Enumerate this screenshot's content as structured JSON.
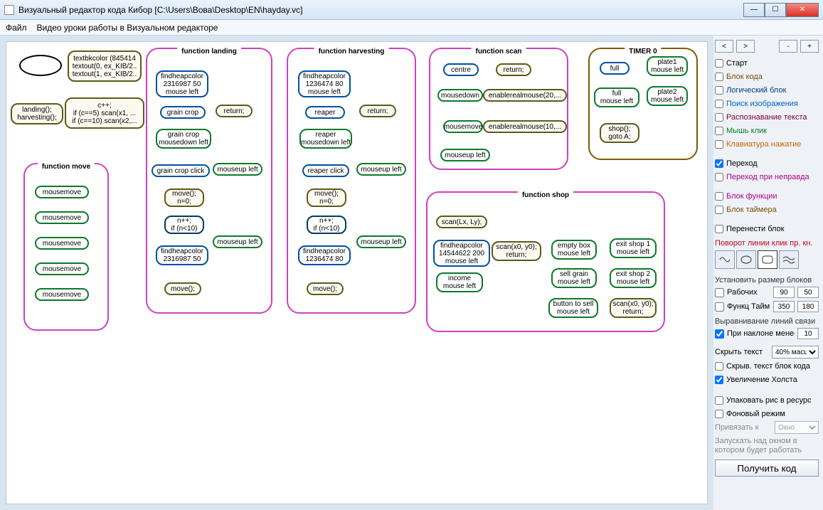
{
  "window": {
    "title": "Визуальный редактор кода Кибор  [C:\\Users\\Вова\\Desktop\\EN\\hayday.vc]"
  },
  "menubar": {
    "file": "Файл",
    "video": "Видео уроки работы в Визуальном редакторе"
  },
  "nav": {
    "back": "<",
    "fwd": ">",
    "minus": "-",
    "plus": "+"
  },
  "tools": [
    {
      "name": "start",
      "label": "Старт",
      "cls": "c-black",
      "checked": false
    },
    {
      "name": "code",
      "label": "Блок кода",
      "cls": "c-brown",
      "checked": false
    },
    {
      "name": "logic",
      "label": "Логический блок",
      "cls": "c-navy",
      "checked": false
    },
    {
      "name": "imgsearch",
      "label": "Поиск изображения",
      "cls": "c-blue",
      "checked": false
    },
    {
      "name": "ocr",
      "label": "Распознавание текста",
      "cls": "c-dred",
      "checked": false
    },
    {
      "name": "mouse",
      "label": "Мышь клик",
      "cls": "c-green",
      "checked": false
    },
    {
      "name": "keyboard",
      "label": "Клавиатура нажатие",
      "cls": "c-orange",
      "checked": false
    }
  ],
  "trans": {
    "go": {
      "label": "Переход",
      "checked": true
    },
    "gofalse": {
      "label": "Переход при неправда",
      "checked": false,
      "cls": "c-magenta"
    }
  },
  "blocks": {
    "func": {
      "label": "Блок функции",
      "cls": "c-magenta"
    },
    "timer": {
      "label": "Блок таймера",
      "cls": "c-brown"
    },
    "move": {
      "label": "Перенести блок"
    }
  },
  "rotate_label": "Поворот линии клик пр. кн.",
  "sizes": {
    "heading": "Установить размер блоков",
    "work": {
      "label": "Рабочих",
      "w": "90",
      "h": "50"
    },
    "func": {
      "label": "Функц Тайм",
      "w": "350",
      "h": "180"
    }
  },
  "align": {
    "heading": "Выравнивание линий связи",
    "slope": {
      "label": "При наклоне менее",
      "val": "10",
      "checked": true
    }
  },
  "hide": {
    "label": "Скрыть текст",
    "value": "40% масш"
  },
  "hideblock": {
    "label": "Скрыв. текст блок кода",
    "checked": false
  },
  "zoom": {
    "label": "Увеличение Холста",
    "checked": true
  },
  "pack": {
    "label": "Упаковать рис в ресурс",
    "checked": false
  },
  "bgmode": {
    "label": "Фоновый режим",
    "checked": false
  },
  "bind": {
    "label": "Привязать к",
    "value": "Окно"
  },
  "hint": "Запускать над окном в котором будет работать",
  "getcode": "Получить код",
  "groups": {
    "move": "function move",
    "land": "function landing",
    "harv": "function harvesting",
    "scan": "function scan",
    "timer": "TIMER 0",
    "shop": "function shop"
  },
  "nodes": {
    "textbk": "textbkcolor (845414\ntextout(0, ex_KIB/2..\ntextout(1, ex_KIB/2..",
    "cplus": "c++;\nif (c==5) scan(x1, ...\nif (c==10) scan(x2,...",
    "landharv": "landing();\nharvesting();",
    "mm1": "mousemove",
    "mm2": "mousemove",
    "mm3": "mousemove",
    "mm4": "mousemove",
    "mm5": "mousemove",
    "l_find": "findheapcolor\n2316987 50\nmouse left",
    "l_grain1": "grain crop",
    "l_return": "return;",
    "l_grain2": "grain crop\nmousedown left",
    "l_grainc": "grain crop click",
    "l_mup1": "mouseup left",
    "l_move1": "move();\nn=0;",
    "l_if": "n++;\nif (n<10)",
    "l_mup2": "mouseup left",
    "l_find2": "findheapcolor\n2316987 50",
    "l_move2": "move();",
    "h_find": "findheapcolor\n1236474 80\nmouse left",
    "h_reap1": "reaper",
    "h_return": "return;",
    "h_reap2": "reaper\nmousedown left",
    "h_reapc": "reaper click",
    "h_mup1": "mouseup left",
    "h_move1": "move();\nn=0;",
    "h_if": "n++;\nif (n<10)",
    "h_mup2": "mouseup left",
    "h_find2": "findheapcolor\n1236474 80",
    "h_move2": "move();",
    "s_centre": "centre",
    "s_return": "return;",
    "s_mdown": "mousedown",
    "s_erm20": "enablerealmouse(20,...",
    "s_mm": "mousemove",
    "s_erm10": "enablerealmouse(10,...",
    "s_mup": "mouseup left",
    "t_full": "full",
    "t_plate1": "plate1\nmouse left",
    "t_fullml": "full\nmouse left",
    "t_plate2": "plate2\nmouse left",
    "t_shop": "shop();\ngoto A;",
    "sh_scan": "scan(Lx, Ly);",
    "sh_find": "findheapcolor\n14544622 200\nmouse left",
    "sh_scanr": "scan(x0, y0);\nreturn;",
    "sh_income": "income\nmouse left",
    "sh_empty": "empty box\nmouse left",
    "sh_exit1": "exit shop 1\nmouse left",
    "sh_sell": "sell grain\nmouse left",
    "sh_exit2": "exit shop 2\nmouse left",
    "sh_button": "button to sell\nmouse left",
    "sh_scanr2": "scan(x0, y0);\nreturn;"
  }
}
